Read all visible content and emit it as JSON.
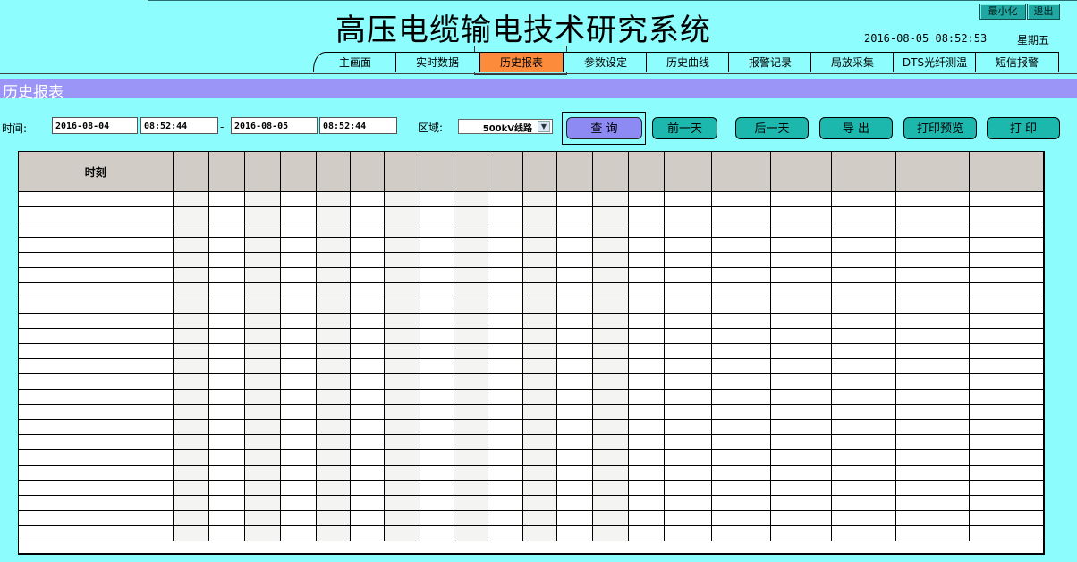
{
  "app": {
    "title": "高压电缆输电技术研究系统",
    "minimize_label": "最小化",
    "exit_label": "退出",
    "datetime": "2016-08-05 08:52:53",
    "weekday": "星期五"
  },
  "nav": {
    "tabs": [
      {
        "label": "主画面"
      },
      {
        "label": "实时数据"
      },
      {
        "label": "历史报表",
        "active": true
      },
      {
        "label": "参数设定"
      },
      {
        "label": "历史曲线"
      },
      {
        "label": "报警记录"
      },
      {
        "label": "局放采集"
      },
      {
        "label": "DTS光纤测温"
      },
      {
        "label": "短信报警"
      }
    ]
  },
  "page": {
    "section_title": "历史报表"
  },
  "query": {
    "time_label": "时间:",
    "start_date": "2016-08-04",
    "start_time": "08:52:44",
    "separator": "-",
    "end_date": "2016-08-05",
    "end_time": "08:52:44",
    "zone_label": "区域:",
    "zone_value": "500kV线路",
    "buttons": {
      "query": "查 询",
      "prev_day": "前一天",
      "next_day": "后一天",
      "export": "导 出",
      "print_preview": "打印预览",
      "print": "打 印"
    }
  },
  "table": {
    "headers": [
      "时刻",
      "",
      "",
      "",
      "",
      "",
      "",
      "",
      "",
      "",
      "",
      "",
      "",
      "",
      "",
      "",
      "",
      "",
      "",
      "",
      ""
    ],
    "row_count": 23
  },
  "colors": {
    "background": "#8cfcfc",
    "active_tab": "#fd8b3c",
    "section_bar": "#9a95f6",
    "button_teal": "#1cb7ad",
    "query_button": "#8e8af4",
    "header_cell": "#d1ccc6"
  }
}
